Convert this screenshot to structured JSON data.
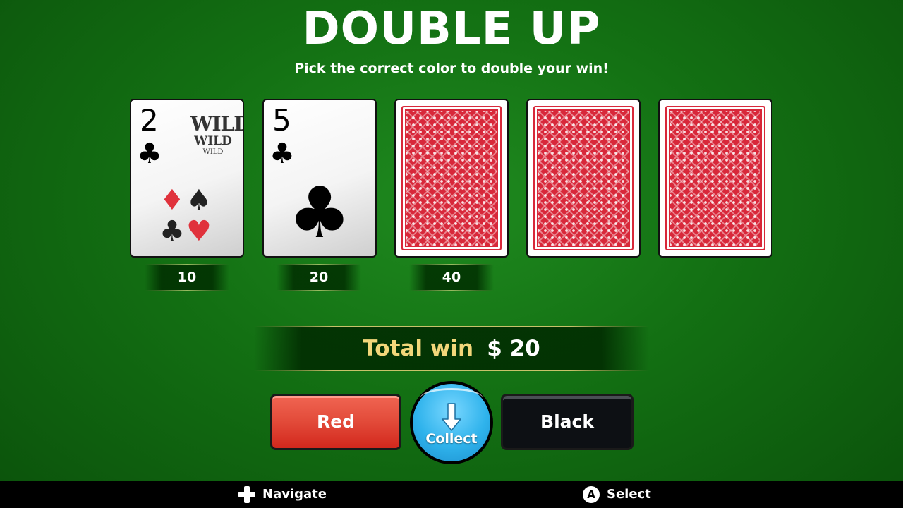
{
  "header": {
    "title": "DOUBLE UP",
    "subtitle": "Pick the correct color to double your win!"
  },
  "cards": [
    {
      "state": "face-up",
      "rank": "2",
      "suit": "clubs",
      "suit_glyph": "♣",
      "wild_text": [
        "WILD",
        "WILD",
        "WILD"
      ],
      "value": "10"
    },
    {
      "state": "face-up",
      "rank": "5",
      "suit": "clubs",
      "suit_glyph": "♣",
      "value": "20"
    },
    {
      "state": "face-down",
      "value": "40"
    },
    {
      "state": "face-down"
    },
    {
      "state": "face-down"
    }
  ],
  "total": {
    "label": "Total win",
    "value": "$ 20"
  },
  "buttons": {
    "red": "Red",
    "collect": "Collect",
    "black": "Black"
  },
  "footer": {
    "navigate": "Navigate",
    "select_glyph": "A",
    "select": "Select"
  },
  "colors": {
    "felt": "#137013",
    "red_button": "#e24a39",
    "black_button": "#0d1014",
    "collect_button": "#2fb3ec",
    "total_label": "#f2d77a",
    "card_back": "#d8283a"
  },
  "icons": {
    "collect": "down-arrow-icon",
    "navigate": "dpad-icon",
    "select": "a-button-icon"
  }
}
